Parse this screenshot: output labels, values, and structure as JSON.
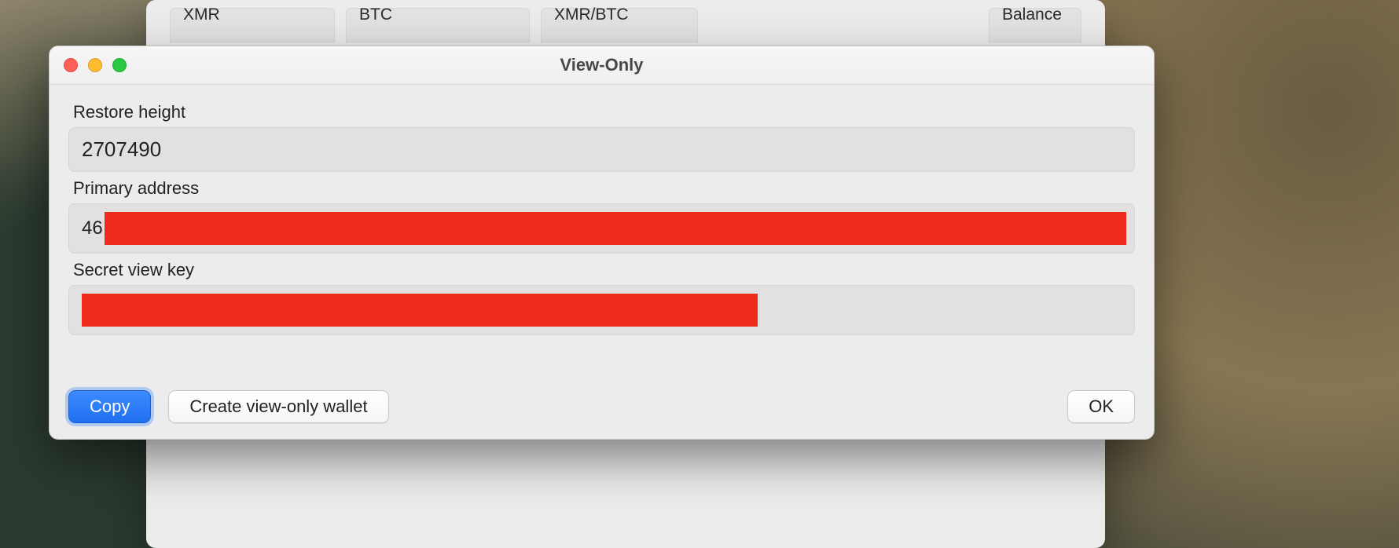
{
  "background_window": {
    "columns": {
      "xmr": "XMR",
      "btc": "BTC",
      "pair": "XMR/BTC",
      "balance": "Balance"
    }
  },
  "dialog": {
    "title": "View-Only",
    "restore_height_label": "Restore height",
    "restore_height_value": "2707490",
    "primary_address_label": "Primary address",
    "primary_address_prefix": "46",
    "secret_view_key_label": "Secret view key",
    "buttons": {
      "copy": "Copy",
      "create": "Create view-only wallet",
      "ok": "OK"
    }
  },
  "colors": {
    "redaction": "#ef2b1c",
    "accent": "#1f6ff0"
  }
}
